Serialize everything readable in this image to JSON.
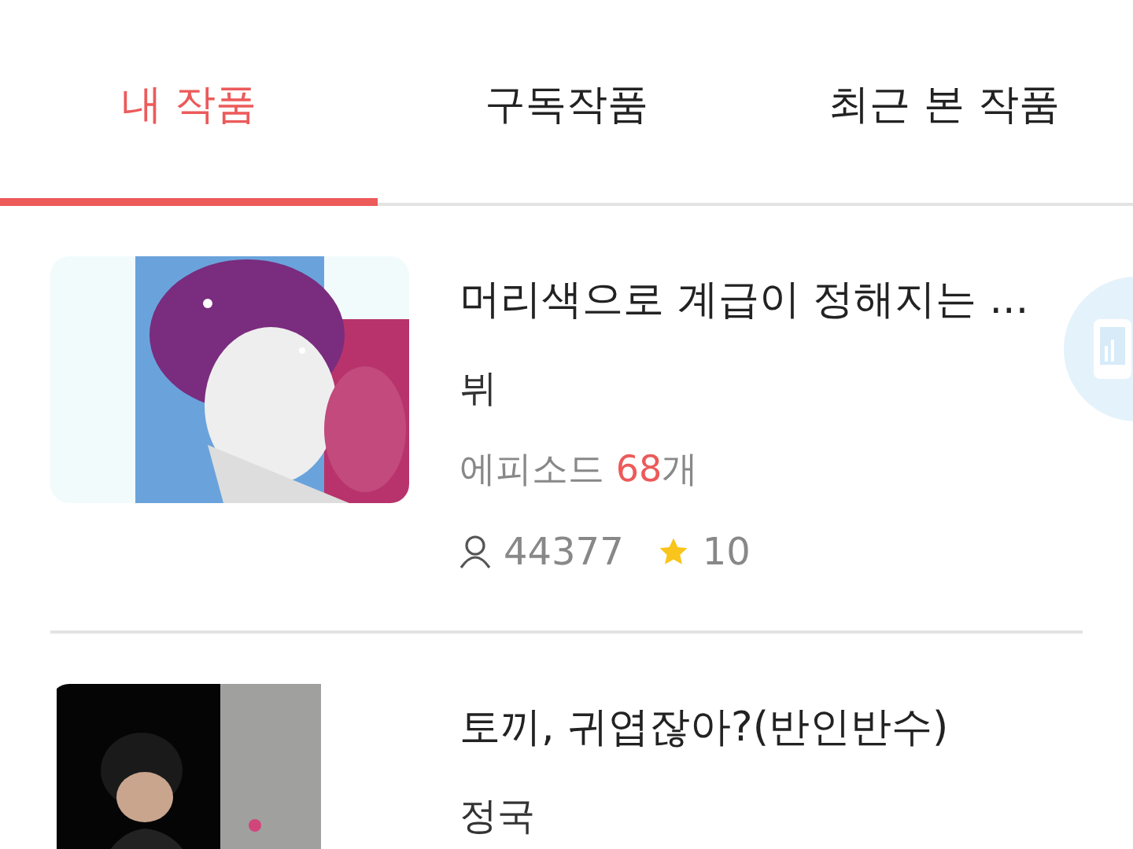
{
  "tabs": [
    {
      "label": "내 작품",
      "selected": true
    },
    {
      "label": "구독작품",
      "selected": false
    },
    {
      "label": "최근 본 작품",
      "selected": false
    }
  ],
  "works": [
    {
      "title": "머리색으로 계급이 정해지는 ...",
      "author": "뷔",
      "episodes": {
        "prefix": "에피소드 ",
        "count": "68",
        "suffix": "개"
      },
      "readers": "44377",
      "rating": "10"
    },
    {
      "title": "토끼, 귀엽잖아?(반인반수)",
      "author": "정국"
    }
  ]
}
